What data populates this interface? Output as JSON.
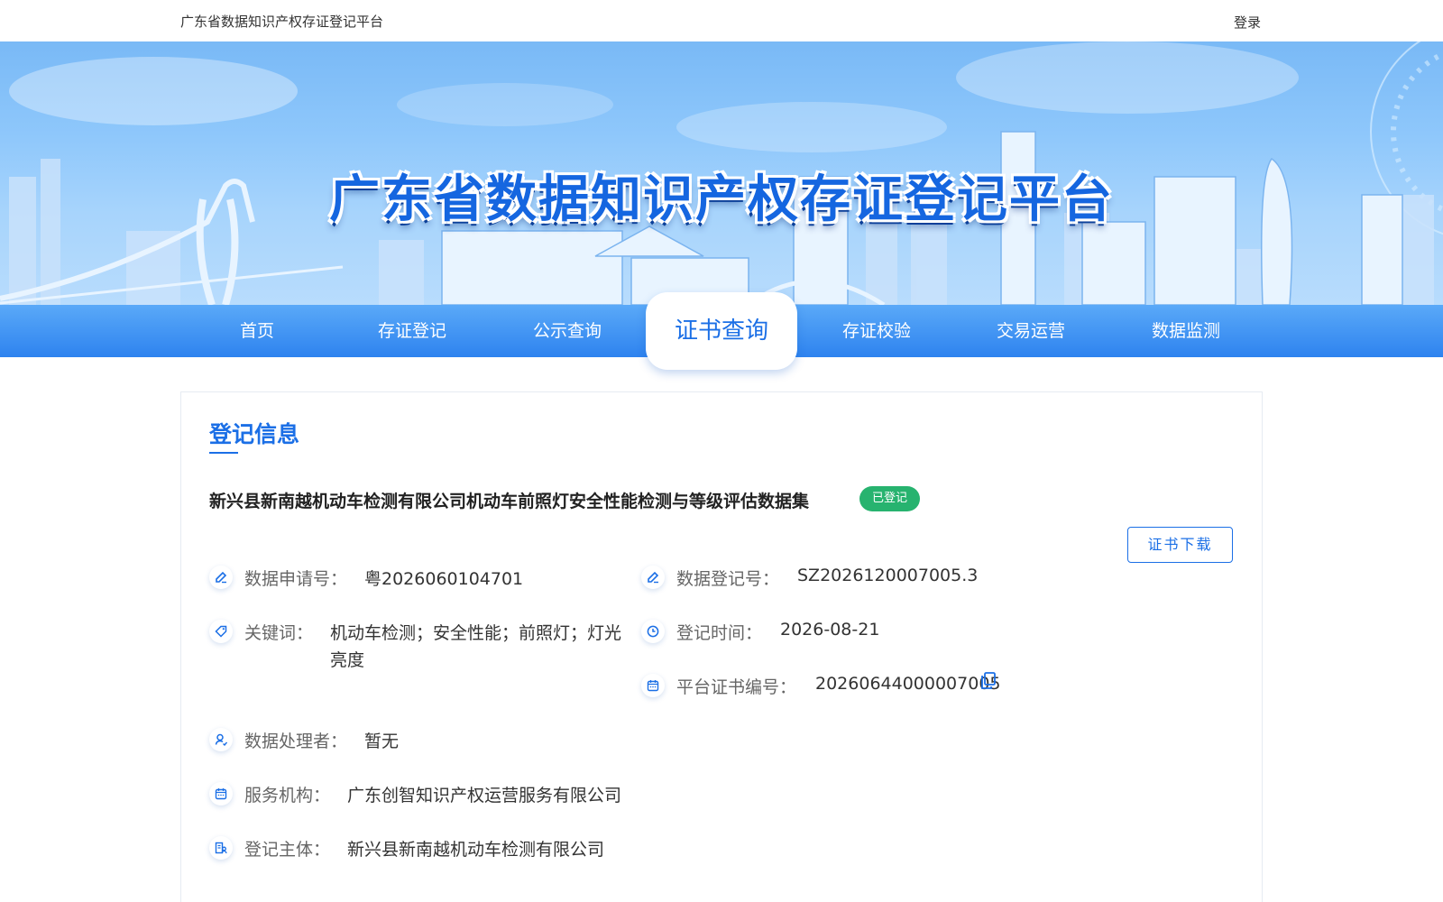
{
  "topbar": {
    "site_title": "广东省数据知识产权存证登记平台",
    "login": "登录"
  },
  "banner": {
    "title": "广东省数据知识产权存证登记平台"
  },
  "nav": {
    "items": [
      "首页",
      "存证登记",
      "公示查询",
      "证书查询",
      "存证校验",
      "交易运营",
      "数据监测"
    ],
    "active": "证书查询"
  },
  "record": {
    "section_title": "登记信息",
    "dataset_name": "新兴县新南越机动车检测有限公司机动车前照灯安全性能检测与等级评估数据集",
    "status_badge": "已登记",
    "download_label": "证书下载",
    "fields": {
      "application_no": {
        "label": "数据申请号：",
        "value": "粤2026060104701",
        "icon": "edit-icon"
      },
      "register_no": {
        "label": "数据登记号：",
        "value": "SZ2026120007005.3",
        "icon": "edit-icon"
      },
      "keywords": {
        "label": "关键词：",
        "value_line1": "机动车检测；安全性能；前照灯；灯光",
        "value_line2": "亮度",
        "icon": "tag-icon"
      },
      "register_time": {
        "label": "登记时间：",
        "value": "2026-08-21",
        "icon": "clock-icon"
      },
      "certificate_no": {
        "label": "平台证书编号：",
        "value": "20260644000007005",
        "icon": "calendar-icon"
      },
      "processor": {
        "label": "数据处理者：",
        "value": "暂无",
        "icon": "user-icon"
      },
      "service_org": {
        "label": "服务机构：",
        "value": "广东创智知识产权运营服务有限公司",
        "icon": "calendar-icon"
      },
      "subject": {
        "label": "登记主体：",
        "value": "新兴县新南越机动车检测有限公司",
        "icon": "building-user-icon"
      }
    }
  },
  "colors": {
    "primary": "#1b6fe6",
    "badge_green": "#27b36f",
    "nav_blue": "#2e83ef"
  }
}
